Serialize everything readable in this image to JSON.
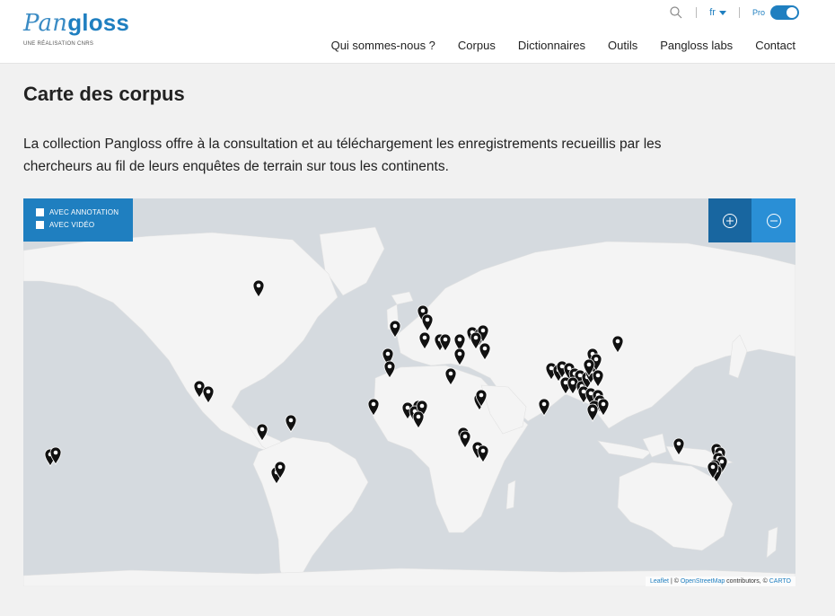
{
  "header": {
    "logo_light": "Pan",
    "logo_bold": "gloss",
    "logo_sub": "UNE RÉALISATION CNRS",
    "lang": "fr",
    "pro_label": "Pro",
    "nav": [
      "Qui sommes-nous ?",
      "Corpus",
      "Dictionnaires",
      "Outils",
      "Pangloss labs",
      "Contact"
    ]
  },
  "page": {
    "title": "Carte des corpus",
    "intro": "La collection Pangloss offre à la consultation et au téléchargement les enregistrements recueillis par les chercheurs au fil de leurs enquêtes de terrain sur tous les continents."
  },
  "map": {
    "filters": [
      "AVEC ANNOTATION",
      "AVEC VIDÉO"
    ],
    "attribution": {
      "leaflet": "Leaflet",
      "sep": " | © ",
      "osm": "OpenStreetMap",
      "contrib": " contributors, © ",
      "carto": "CARTO"
    }
  },
  "colors": {
    "accent": "#1f7fc0",
    "map_background": "#d5dadf",
    "land": "#f4f4f4"
  }
}
